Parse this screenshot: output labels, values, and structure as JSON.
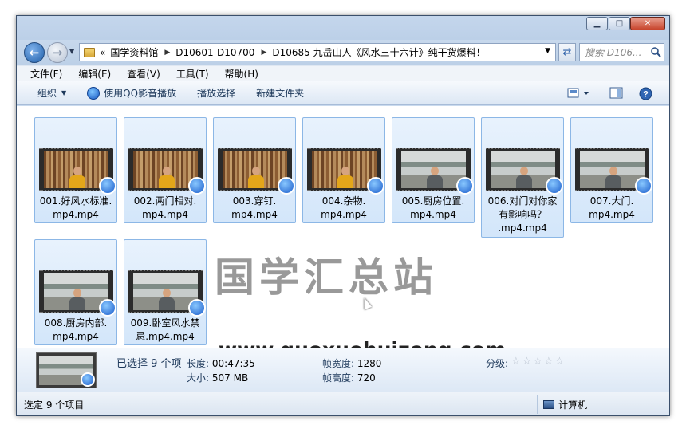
{
  "window": {
    "controls": {
      "minimize": "▁",
      "maximize": "□",
      "close": "✕"
    }
  },
  "nav": {
    "address_segments": [
      "«",
      "国学资料馆",
      "D10601-D10700",
      "D10685 九岳山人《风水三十六计》纯干货爆料！"
    ],
    "search_placeholder": "搜索 D106..."
  },
  "menubar": {
    "items": [
      "文件(F)",
      "编辑(E)",
      "查看(V)",
      "工具(T)",
      "帮助(H)"
    ]
  },
  "toolbar": {
    "organize": "组织",
    "play_qq": "使用QQ影音播放",
    "play_selected": "播放选择",
    "new_folder": "新建文件夹"
  },
  "files": [
    {
      "name_line1": "001.好风水标准.",
      "name_line2": "mp4.mp4",
      "name_line3": "",
      "scene": "shelf",
      "person": "yellow"
    },
    {
      "name_line1": "002.两门相对.",
      "name_line2": "mp4.mp4",
      "name_line3": "",
      "scene": "shelf",
      "person": "yellow"
    },
    {
      "name_line1": "003.穿钉.",
      "name_line2": "mp4.mp4",
      "name_line3": "",
      "scene": "shelf",
      "person": "yellow"
    },
    {
      "name_line1": "004.杂物.",
      "name_line2": "mp4.mp4",
      "name_line3": "",
      "scene": "shelf",
      "person": "yellow"
    },
    {
      "name_line1": "005.厨房位置.",
      "name_line2": "mp4.mp4",
      "name_line3": "",
      "scene": "mural",
      "person": "dark"
    },
    {
      "name_line1": "006.对门对你家",
      "name_line2": "有影响吗？",
      "name_line3": ".mp4.mp4",
      "scene": "mural",
      "person": "dark"
    },
    {
      "name_line1": "007.大门.",
      "name_line2": "mp4.mp4",
      "name_line3": "",
      "scene": "mural",
      "person": "dark"
    },
    {
      "name_line1": "008.厨房内部.",
      "name_line2": "mp4.mp4",
      "name_line3": "",
      "scene": "mural",
      "person": "dark"
    },
    {
      "name_line1": "009.卧室风水禁",
      "name_line2": "忌.mp4.mp4",
      "name_line3": "",
      "scene": "mural",
      "person": "dark"
    }
  ],
  "watermark": {
    "cn": "国学汇总站",
    "url": "www.guoxuehuizong.com"
  },
  "details": {
    "selected": "已选择 9 个项",
    "length_label": "长度:",
    "length_value": "00:47:35",
    "size_label": "大小:",
    "size_value": "507 MB",
    "frame_width_label": "帧宽度:",
    "frame_width_value": "1280",
    "frame_height_label": "帧高度:",
    "frame_height_value": "720",
    "rating_label": "分级:",
    "rating_stars": 0,
    "rating_max": 5
  },
  "status": {
    "left": "选定 9 个项目",
    "right": "计算机"
  }
}
